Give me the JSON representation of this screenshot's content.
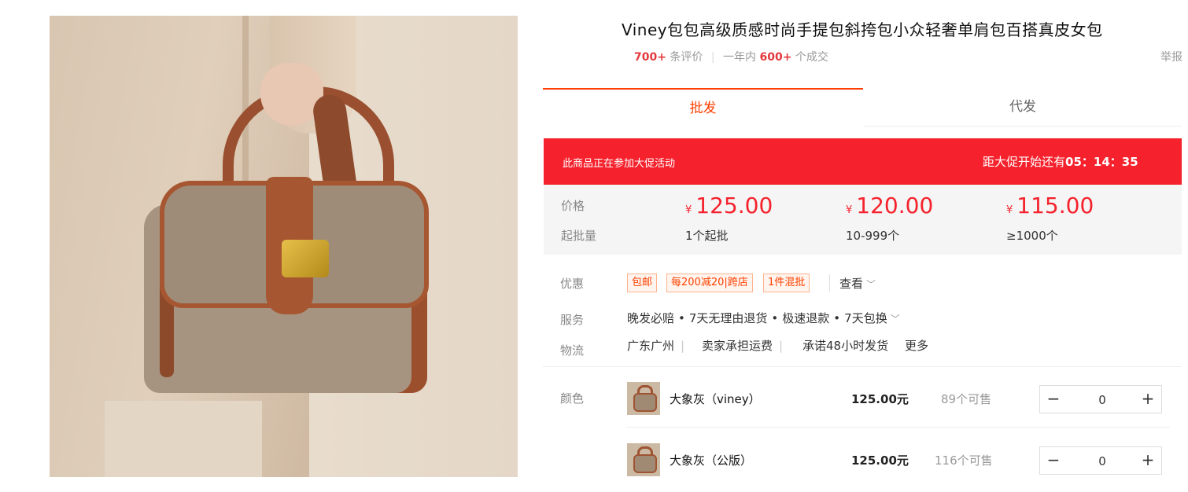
{
  "title": "Viney包包高级质感时尚手提包斜挎包小众轻奢单肩包百搭真皮女包",
  "stats": {
    "reviews_count": "700+",
    "reviews_label": "条评价",
    "year_label": "一年内",
    "deals_count": "600+",
    "deals_label": "个成交"
  },
  "report_label": "举报",
  "tabs": [
    {
      "label": "批发",
      "active": true
    },
    {
      "label": "代发",
      "active": false
    }
  ],
  "promo": {
    "left_text": "此商品正在参加大促活动",
    "countdown_label": "距大促开始还有",
    "countdown": "05：14：35"
  },
  "price_box": {
    "price_label": "价格",
    "qty_label": "起批量",
    "currency": "¥",
    "tiers": [
      {
        "price": "125.00",
        "qty": "1个起批"
      },
      {
        "price": "120.00",
        "qty": "10-999个"
      },
      {
        "price": "115.00",
        "qty": "≥1000个"
      }
    ]
  },
  "offers": {
    "label": "优惠",
    "tags": [
      "包邮",
      "每200减20|跨店",
      "1件混批"
    ],
    "view_label": "查看"
  },
  "service": {
    "label": "服务",
    "items": [
      "晚发必赔",
      "7天无理由退货",
      "极速退款",
      "7天包换"
    ]
  },
  "logistics": {
    "label": "物流",
    "location": "广东广州",
    "shipping": "卖家承担运费",
    "promise": "承诺48小时发货",
    "more": "更多"
  },
  "color": {
    "label": "颜色",
    "skus": [
      {
        "name": "大象灰（viney）",
        "price": "125.00元",
        "stock": "89个可售",
        "qty": "0"
      },
      {
        "name": "大象灰（公版）",
        "price": "125.00元",
        "stock": "116个可售",
        "qty": "0"
      }
    ]
  },
  "stepper_minus": "−",
  "stepper_plus": "+",
  "colors": {
    "accent": "#ff4000",
    "promo_red": "#f5222d",
    "price_red": "#f5222d"
  }
}
